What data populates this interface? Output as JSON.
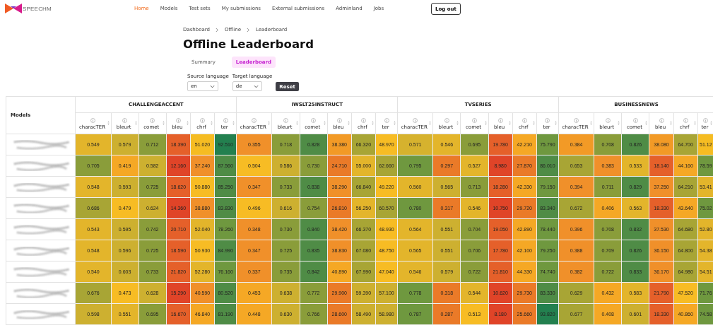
{
  "brand": "SPEECHM",
  "nav": [
    {
      "label": "Home",
      "selected": true
    },
    {
      "label": "Models",
      "selected": false
    },
    {
      "label": "Test sets",
      "selected": false
    },
    {
      "label": "My submissions",
      "selected": false
    },
    {
      "label": "External submissions",
      "selected": false
    },
    {
      "label": "Adminland",
      "selected": false
    },
    {
      "label": "Jobs",
      "selected": false
    }
  ],
  "logout": "Log out",
  "breadcrumb": [
    "Dashboard",
    "Offline",
    "Leaderboard"
  ],
  "title": "Offline Leaderboard",
  "tabs": [
    {
      "label": "Summary",
      "selected": false
    },
    {
      "label": "Leaderboard",
      "selected": true
    }
  ],
  "filters": [
    {
      "label": "Source language",
      "value": "en"
    },
    {
      "label": "Target language",
      "value": "de"
    }
  ],
  "reset": "Reset",
  "table": {
    "models_header": "Models",
    "groups": [
      {
        "name": "CHALLENGEACCENT",
        "metrics": [
          "characTER",
          "bleurt",
          "comet",
          "bleu",
          "chrf",
          "ter"
        ]
      },
      {
        "name": "IWSLT25INSTRUCT",
        "metrics": [
          "characTER",
          "bleurt",
          "comet",
          "bleu",
          "chrf",
          "ter"
        ]
      },
      {
        "name": "TVSERIES",
        "metrics": [
          "characTER",
          "bleurt",
          "comet",
          "bleu",
          "chrf",
          "ter"
        ]
      },
      {
        "name": "BUSINESSNEWS",
        "metrics": [
          "characTER",
          "bleurt",
          "comet",
          "bleu",
          "chrf",
          "ter"
        ]
      }
    ],
    "rows": [
      {
        "cells": [
          {
            "value": "0.549",
            "color": "#e3b52b"
          },
          {
            "value": "0.579",
            "color": "#cdb030"
          },
          {
            "value": "0.712",
            "color": "#8a9d3a"
          },
          {
            "value": "18.390",
            "color": "#e5602a"
          },
          {
            "value": "51.020",
            "color": "#f5bc22"
          },
          {
            "value": "92.510",
            "color": "#23804f"
          },
          {
            "value": "0.355",
            "color": "#f0902a"
          },
          {
            "value": "0.718",
            "color": "#8a9d3a"
          },
          {
            "value": "0.828",
            "color": "#4f8c46"
          },
          {
            "value": "38.380",
            "color": "#f29a26"
          },
          {
            "value": "66.320",
            "color": "#a8a535"
          },
          {
            "value": "48.970",
            "color": "#f7bc24"
          },
          {
            "value": "0.571",
            "color": "#d6b22e"
          },
          {
            "value": "0.546",
            "color": "#e3b52b"
          },
          {
            "value": "0.695",
            "color": "#8a9d3a"
          },
          {
            "value": "19.780",
            "color": "#e5602a"
          },
          {
            "value": "42.210",
            "color": "#f5a825"
          },
          {
            "value": "75.790",
            "color": "#6f983f"
          },
          {
            "value": "0.384",
            "color": "#f29a26"
          },
          {
            "value": "0.708",
            "color": "#8a9d3a"
          },
          {
            "value": "0.826",
            "color": "#4f8c46"
          },
          {
            "value": "38.080",
            "color": "#f29a26"
          },
          {
            "value": "64.700",
            "color": "#a8a535"
          },
          {
            "value": "51.12",
            "color": "#f5bc22"
          }
        ]
      },
      {
        "cells": [
          {
            "value": "0.705",
            "color": "#8a9d3a"
          },
          {
            "value": "0.419",
            "color": "#f5a825"
          },
          {
            "value": "0.582",
            "color": "#cdb030"
          },
          {
            "value": "12.160",
            "color": "#e04428"
          },
          {
            "value": "37.240",
            "color": "#f0902a"
          },
          {
            "value": "87.560",
            "color": "#4f8c46"
          },
          {
            "value": "0.504",
            "color": "#f7bc24"
          },
          {
            "value": "0.586",
            "color": "#cdb030"
          },
          {
            "value": "0.730",
            "color": "#8a9d3a"
          },
          {
            "value": "24.710",
            "color": "#ea7a28"
          },
          {
            "value": "55.000",
            "color": "#e3b52b"
          },
          {
            "value": "62.660",
            "color": "#a8a535"
          },
          {
            "value": "0.795",
            "color": "#6f983f"
          },
          {
            "value": "0.297",
            "color": "#ea7a28"
          },
          {
            "value": "0.527",
            "color": "#e3b52b"
          },
          {
            "value": "8.980",
            "color": "#e04428"
          },
          {
            "value": "27.870",
            "color": "#ea7a28"
          },
          {
            "value": "86.010",
            "color": "#4f8c46"
          },
          {
            "value": "0.653",
            "color": "#a8a535"
          },
          {
            "value": "0.383",
            "color": "#f0902a"
          },
          {
            "value": "0.533",
            "color": "#e3b52b"
          },
          {
            "value": "18.140",
            "color": "#e5602a"
          },
          {
            "value": "44.160",
            "color": "#f5a825"
          },
          {
            "value": "78.59",
            "color": "#6f983f"
          }
        ]
      },
      {
        "cells": [
          {
            "value": "0.548",
            "color": "#e3b52b"
          },
          {
            "value": "0.593",
            "color": "#cdb030"
          },
          {
            "value": "0.725",
            "color": "#8a9d3a"
          },
          {
            "value": "18.620",
            "color": "#e5602a"
          },
          {
            "value": "50.880",
            "color": "#f7bc24"
          },
          {
            "value": "85.250",
            "color": "#4f8c46"
          },
          {
            "value": "0.347",
            "color": "#f0902a"
          },
          {
            "value": "0.733",
            "color": "#8a9d3a"
          },
          {
            "value": "0.838",
            "color": "#4f8c46"
          },
          {
            "value": "38.290",
            "color": "#f0902a"
          },
          {
            "value": "66.840",
            "color": "#a8a535"
          },
          {
            "value": "49.220",
            "color": "#f7bc24"
          },
          {
            "value": "0.560",
            "color": "#e3b52b"
          },
          {
            "value": "0.565",
            "color": "#cdb030"
          },
          {
            "value": "0.713",
            "color": "#8a9d3a"
          },
          {
            "value": "18.280",
            "color": "#e5602a"
          },
          {
            "value": "42.330",
            "color": "#f5a825"
          },
          {
            "value": "79.150",
            "color": "#6f983f"
          },
          {
            "value": "0.394",
            "color": "#f0902a"
          },
          {
            "value": "0.711",
            "color": "#8a9d3a"
          },
          {
            "value": "0.829",
            "color": "#4f8c46"
          },
          {
            "value": "37.250",
            "color": "#f0902a"
          },
          {
            "value": "64.210",
            "color": "#a8a535"
          },
          {
            "value": "53.41",
            "color": "#e3b52b"
          }
        ]
      },
      {
        "cells": [
          {
            "value": "0.686",
            "color": "#a8a535"
          },
          {
            "value": "0.479",
            "color": "#f7bc24"
          },
          {
            "value": "0.624",
            "color": "#cdb030"
          },
          {
            "value": "14.360",
            "color": "#e04428"
          },
          {
            "value": "38.880",
            "color": "#f0902a"
          },
          {
            "value": "83.830",
            "color": "#4f8c46"
          },
          {
            "value": "0.496",
            "color": "#f7bc24"
          },
          {
            "value": "0.616",
            "color": "#cdb030"
          },
          {
            "value": "0.754",
            "color": "#8a9d3a"
          },
          {
            "value": "26.810",
            "color": "#ea7a28"
          },
          {
            "value": "56.250",
            "color": "#e3b52b"
          },
          {
            "value": "60.570",
            "color": "#a8a535"
          },
          {
            "value": "0.780",
            "color": "#6f983f"
          },
          {
            "value": "0.317",
            "color": "#ea7a28"
          },
          {
            "value": "0.546",
            "color": "#e3b52b"
          },
          {
            "value": "10.750",
            "color": "#e04428"
          },
          {
            "value": "29.720",
            "color": "#ea7a28"
          },
          {
            "value": "83.340",
            "color": "#4f8c46"
          },
          {
            "value": "0.672",
            "color": "#a8a535"
          },
          {
            "value": "0.406",
            "color": "#f5a825"
          },
          {
            "value": "0.563",
            "color": "#e3b52b"
          },
          {
            "value": "18.330",
            "color": "#e5602a"
          },
          {
            "value": "43.640",
            "color": "#f5a825"
          },
          {
            "value": "75.02",
            "color": "#6f983f"
          }
        ]
      },
      {
        "cells": [
          {
            "value": "0.543",
            "color": "#e3b52b"
          },
          {
            "value": "0.595",
            "color": "#cdb030"
          },
          {
            "value": "0.742",
            "color": "#8a9d3a"
          },
          {
            "value": "20.710",
            "color": "#e5602a"
          },
          {
            "value": "52.040",
            "color": "#e3b52b"
          },
          {
            "value": "78.260",
            "color": "#6f983f"
          },
          {
            "value": "0.348",
            "color": "#f0902a"
          },
          {
            "value": "0.730",
            "color": "#8a9d3a"
          },
          {
            "value": "0.840",
            "color": "#4f8c46"
          },
          {
            "value": "38.420",
            "color": "#f0902a"
          },
          {
            "value": "66.370",
            "color": "#a8a535"
          },
          {
            "value": "48.930",
            "color": "#f7bc24"
          },
          {
            "value": "0.564",
            "color": "#e3b52b"
          },
          {
            "value": "0.551",
            "color": "#cdb030"
          },
          {
            "value": "0.704",
            "color": "#8a9d3a"
          },
          {
            "value": "19.050",
            "color": "#e5602a"
          },
          {
            "value": "42.890",
            "color": "#f5a825"
          },
          {
            "value": "78.440",
            "color": "#6f983f"
          },
          {
            "value": "0.396",
            "color": "#f0902a"
          },
          {
            "value": "0.708",
            "color": "#8a9d3a"
          },
          {
            "value": "0.832",
            "color": "#4f8c46"
          },
          {
            "value": "37.530",
            "color": "#f0902a"
          },
          {
            "value": "64.680",
            "color": "#a8a535"
          },
          {
            "value": "52.80",
            "color": "#e3b52b"
          }
        ]
      },
      {
        "cells": [
          {
            "value": "0.548",
            "color": "#e3b52b"
          },
          {
            "value": "0.596",
            "color": "#cdb030"
          },
          {
            "value": "0.725",
            "color": "#8a9d3a"
          },
          {
            "value": "18.590",
            "color": "#e5602a"
          },
          {
            "value": "50.930",
            "color": "#f7bc24"
          },
          {
            "value": "84.990",
            "color": "#4f8c46"
          },
          {
            "value": "0.347",
            "color": "#f0902a"
          },
          {
            "value": "0.725",
            "color": "#8a9d3a"
          },
          {
            "value": "0.835",
            "color": "#4f8c46"
          },
          {
            "value": "38.830",
            "color": "#f0902a"
          },
          {
            "value": "67.080",
            "color": "#a8a535"
          },
          {
            "value": "48.750",
            "color": "#f7bc24"
          },
          {
            "value": "0.565",
            "color": "#e3b52b"
          },
          {
            "value": "0.551",
            "color": "#cdb030"
          },
          {
            "value": "0.706",
            "color": "#8a9d3a"
          },
          {
            "value": "17.780",
            "color": "#e5602a"
          },
          {
            "value": "42.100",
            "color": "#f5a825"
          },
          {
            "value": "79.250",
            "color": "#6f983f"
          },
          {
            "value": "0.388",
            "color": "#f0902a"
          },
          {
            "value": "0.709",
            "color": "#8a9d3a"
          },
          {
            "value": "0.826",
            "color": "#4f8c46"
          },
          {
            "value": "36.150",
            "color": "#f0902a"
          },
          {
            "value": "64.800",
            "color": "#a8a535"
          },
          {
            "value": "54.38",
            "color": "#e3b52b"
          }
        ]
      },
      {
        "cells": [
          {
            "value": "0.540",
            "color": "#e3b52b"
          },
          {
            "value": "0.603",
            "color": "#cdb030"
          },
          {
            "value": "0.733",
            "color": "#8a9d3a"
          },
          {
            "value": "21.820",
            "color": "#e5602a"
          },
          {
            "value": "52.280",
            "color": "#e3b52b"
          },
          {
            "value": "76.160",
            "color": "#6f983f"
          },
          {
            "value": "0.337",
            "color": "#f0902a"
          },
          {
            "value": "0.735",
            "color": "#8a9d3a"
          },
          {
            "value": "0.842",
            "color": "#4f8c46"
          },
          {
            "value": "40.890",
            "color": "#f5a825"
          },
          {
            "value": "67.990",
            "color": "#a8a535"
          },
          {
            "value": "47.040",
            "color": "#f7bc24"
          },
          {
            "value": "0.546",
            "color": "#e3b52b"
          },
          {
            "value": "0.579",
            "color": "#cdb030"
          },
          {
            "value": "0.722",
            "color": "#8a9d3a"
          },
          {
            "value": "21.810",
            "color": "#e5602a"
          },
          {
            "value": "44.330",
            "color": "#f5a825"
          },
          {
            "value": "74.740",
            "color": "#6f983f"
          },
          {
            "value": "0.382",
            "color": "#f0902a"
          },
          {
            "value": "0.722",
            "color": "#8a9d3a"
          },
          {
            "value": "0.833",
            "color": "#4f8c46"
          },
          {
            "value": "36.170",
            "color": "#f0902a"
          },
          {
            "value": "64.980",
            "color": "#a8a535"
          },
          {
            "value": "54.51",
            "color": "#e3b52b"
          }
        ]
      },
      {
        "cells": [
          {
            "value": "0.676",
            "color": "#a8a535"
          },
          {
            "value": "0.473",
            "color": "#f7bc24"
          },
          {
            "value": "0.628",
            "color": "#cdb030"
          },
          {
            "value": "15.290",
            "color": "#e04428"
          },
          {
            "value": "40.590",
            "color": "#f0902a"
          },
          {
            "value": "80.520",
            "color": "#4f8c46"
          },
          {
            "value": "0.453",
            "color": "#f5a825"
          },
          {
            "value": "0.638",
            "color": "#cdb030"
          },
          {
            "value": "0.772",
            "color": "#8a9d3a"
          },
          {
            "value": "29.900",
            "color": "#ea7a28"
          },
          {
            "value": "59.390",
            "color": "#cdb030"
          },
          {
            "value": "57.100",
            "color": "#cdb030"
          },
          {
            "value": "0.778",
            "color": "#6f983f"
          },
          {
            "value": "0.318",
            "color": "#ea7a28"
          },
          {
            "value": "0.544",
            "color": "#e3b52b"
          },
          {
            "value": "10.620",
            "color": "#e04428"
          },
          {
            "value": "29.730",
            "color": "#ea7a28"
          },
          {
            "value": "83.330",
            "color": "#4f8c46"
          },
          {
            "value": "0.629",
            "color": "#a8a535"
          },
          {
            "value": "0.432",
            "color": "#f5a825"
          },
          {
            "value": "0.583",
            "color": "#e3b52b"
          },
          {
            "value": "21.790",
            "color": "#e5602a"
          },
          {
            "value": "47.520",
            "color": "#f7bc24"
          },
          {
            "value": "71.76",
            "color": "#6f983f"
          }
        ]
      },
      {
        "cells": [
          {
            "value": "0.598",
            "color": "#cdb030"
          },
          {
            "value": "0.551",
            "color": "#e3b52b"
          },
          {
            "value": "0.695",
            "color": "#8a9d3a"
          },
          {
            "value": "16.670",
            "color": "#e5602a"
          },
          {
            "value": "46.840",
            "color": "#f5a825"
          },
          {
            "value": "81.190",
            "color": "#4f8c46"
          },
          {
            "value": "0.448",
            "color": "#f5a825"
          },
          {
            "value": "0.630",
            "color": "#cdb030"
          },
          {
            "value": "0.766",
            "color": "#8a9d3a"
          },
          {
            "value": "28.600",
            "color": "#ea7a28"
          },
          {
            "value": "58.490",
            "color": "#cdb030"
          },
          {
            "value": "58.980",
            "color": "#cdb030"
          },
          {
            "value": "0.787",
            "color": "#6f983f"
          },
          {
            "value": "0.287",
            "color": "#ea7a28"
          },
          {
            "value": "0.513",
            "color": "#f7bc24"
          },
          {
            "value": "8.180",
            "color": "#e04428"
          },
          {
            "value": "25.660",
            "color": "#ea7a28"
          },
          {
            "value": "93.820",
            "color": "#23804f"
          },
          {
            "value": "0.677",
            "color": "#a8a535"
          },
          {
            "value": "0.408",
            "color": "#f5a825"
          },
          {
            "value": "0.601",
            "color": "#cdb030"
          },
          {
            "value": "18.330",
            "color": "#e5602a"
          },
          {
            "value": "40.860",
            "color": "#f5a825"
          },
          {
            "value": "74.58",
            "color": "#6f983f"
          }
        ]
      }
    ]
  }
}
